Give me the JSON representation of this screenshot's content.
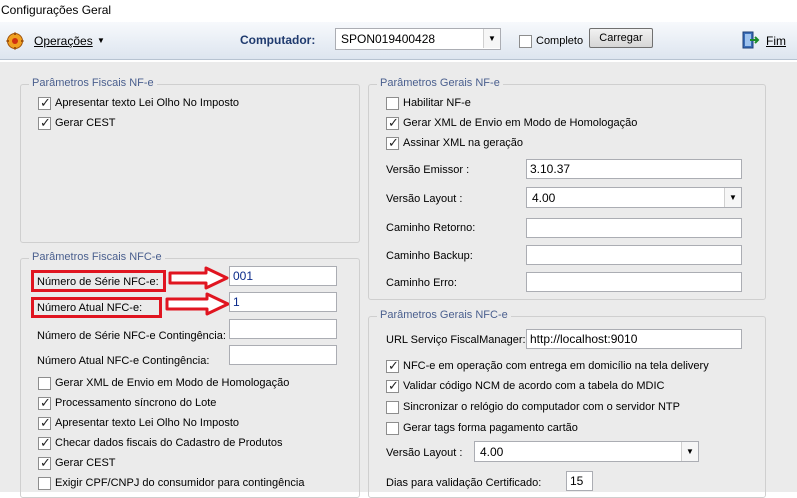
{
  "window": {
    "title": "Configurações Geral"
  },
  "toolbar": {
    "operacoes_label": "Operações",
    "computador_label": "Computador:",
    "computador_value": "SPON019400428",
    "completo_label": "Completo",
    "carregar_label": "Carregar",
    "fim_label": "Fim"
  },
  "fiscais_nfe": {
    "title": "Parâmetros Fiscais NF-e",
    "items": [
      {
        "label": "Apresentar texto Lei Olho No Imposto",
        "checked": true
      },
      {
        "label": "Gerar CEST",
        "checked": true
      }
    ]
  },
  "gerais_nfe": {
    "title": "Parâmetros Gerais NF-e",
    "items": [
      {
        "label": "Habilitar NF-e",
        "checked": false
      },
      {
        "label": "Gerar XML de Envio em Modo de Homologação",
        "checked": true
      },
      {
        "label": "Assinar XML na geração",
        "checked": true
      }
    ],
    "versao_emissor_label": "Versão Emissor :",
    "versao_emissor_value": "3.10.37",
    "versao_layout_label": "Versão Layout :",
    "versao_layout_value": "4.00",
    "caminho_retorno_label": "Caminho Retorno:",
    "caminho_backup_label": "Caminho Backup:",
    "caminho_erro_label": "Caminho Erro:"
  },
  "fiscais_nfce": {
    "title": "Parâmetros Fiscais NFC-e",
    "serie_label": "Número de Série NFC-e:",
    "serie_value": "001",
    "atual_label": "Número Atual NFC-e:",
    "atual_value": "1",
    "serie_cont_label": "Número de Série NFC-e Contingência:",
    "atual_cont_label": "Número Atual NFC-e Contingência:",
    "items": [
      {
        "label": "Gerar XML de Envio em Modo de Homologação",
        "checked": false
      },
      {
        "label": "Processamento síncrono do Lote",
        "checked": true
      },
      {
        "label": "Apresentar texto Lei Olho No Imposto",
        "checked": true
      },
      {
        "label": "Checar dados fiscais do Cadastro de Produtos",
        "checked": true
      },
      {
        "label": "Gerar CEST",
        "checked": true
      },
      {
        "label": "Exigir CPF/CNPJ do consumidor para contingência",
        "checked": false
      }
    ]
  },
  "gerais_nfce": {
    "title": "Parâmetros Gerais NFC-e",
    "url_label": "URL Serviço FiscalManager:",
    "url_value": "http://localhost:9010",
    "items": [
      {
        "label": "NFC-e em operação com entrega em domicílio na tela delivery",
        "checked": true
      },
      {
        "label": "Validar código NCM de acordo com a tabela do MDIC",
        "checked": true
      },
      {
        "label": "Sincronizar o relógio do computador com o servidor NTP",
        "checked": false
      },
      {
        "label": "Gerar tags forma pagamento cartão",
        "checked": false
      }
    ],
    "versao_layout_label": "Versão Layout :",
    "versao_layout_value": "4.00",
    "dias_label": "Dias para validação Certificado:",
    "dias_value": "15"
  },
  "colors": {
    "annotation": "#e01520",
    "group_title": "#4a5f8e"
  }
}
